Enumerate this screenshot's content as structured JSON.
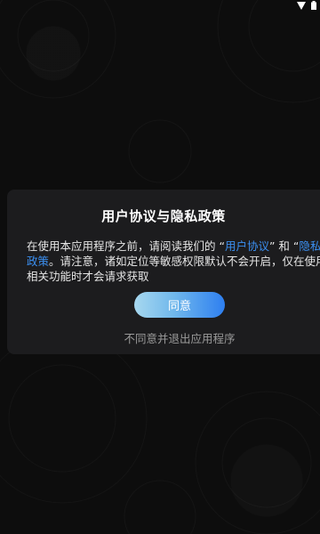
{
  "status_bar": {
    "icons": [
      "signal-icon",
      "battery-icon"
    ]
  },
  "dialog": {
    "title": "用户协议与隐私政策",
    "body_prefix": "在使用本应用程序之前，请阅读我们的 “",
    "user_agreement_link": "用户协议",
    "body_middle": "” 和 “",
    "privacy_policy_link": "隐私政策",
    "body_suffix": "。请注意，诸如定位等敏感权限默认不会开启，仅在使用相关功能时才会请求获取",
    "agree_label": "同意",
    "decline_label": "不同意并退出应用程序"
  },
  "colors": {
    "background": "#0d0d0d",
    "dialog_background": "#1c1c1e",
    "link": "#3b8ff0",
    "button_gradient_start": "#a7d8ef",
    "button_gradient_end": "#2e7ff0"
  }
}
